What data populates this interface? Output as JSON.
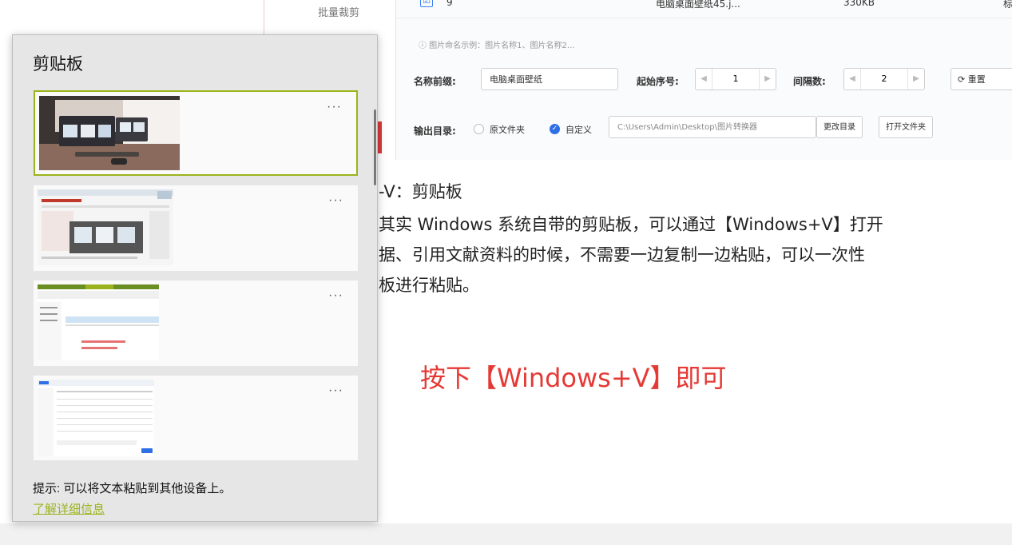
{
  "app": {
    "menu_item": "批量裁剪",
    "row": {
      "check": "☑",
      "index": "9",
      "name": "电脑桌面壁纸45.j...",
      "size": "330KB",
      "extra": "标"
    },
    "hint": "ⓘ 图片命名示例：图片名称1、图片名称2...",
    "name_prefix_label": "名称前缀:",
    "name_prefix_value": "电脑桌面壁纸",
    "start_label": "起始序号:",
    "start_value": "1",
    "interval_label": "间隔数:",
    "interval_value": "2",
    "reset_label": "⟳ 重置",
    "output_label": "输出目录:",
    "radio_original": "原文件夹",
    "radio_custom": "自定义",
    "output_path": "C:\\Users\\Admin\\Desktop\\图片转换器",
    "change_dir_button": "更改目录",
    "open_folder_button": "打开文件夹"
  },
  "article": {
    "heading": "-V：剪贴板",
    "lines": [
      "其实 Windows 系统自带的剪贴板，可以通过【Windows+V】打开",
      "据、引用文献资料的时候，不需要一边复制一边粘贴，可以一次性",
      "板进行粘贴。"
    ],
    "red_note": "按下【Windows+V】即可"
  },
  "clipboard": {
    "title": "剪贴板",
    "more_label": "···",
    "hint": "提示: 可以将文本粘贴到其他设备上。",
    "learn_more": "了解详细信息",
    "accent_color": "#9bb41e"
  }
}
